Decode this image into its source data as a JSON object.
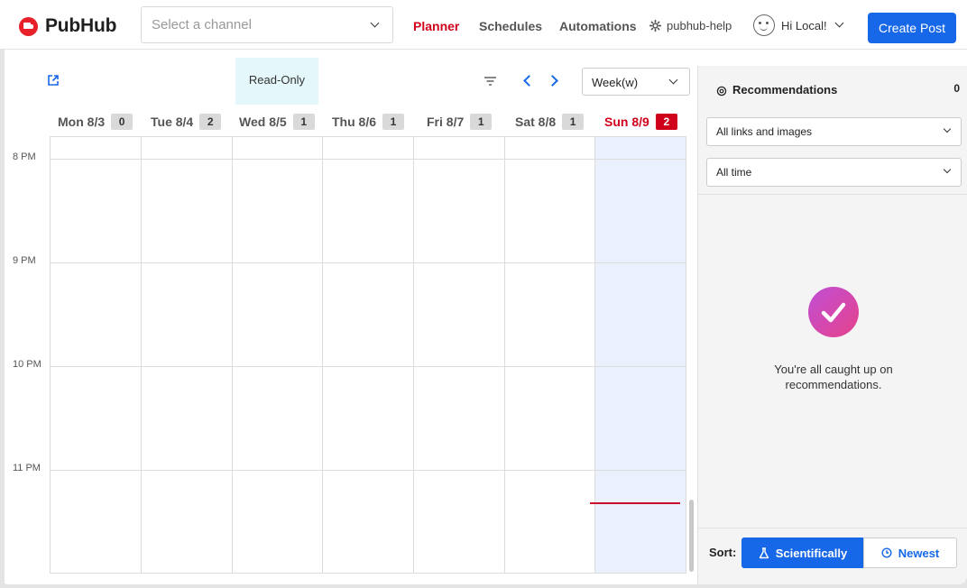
{
  "header": {
    "brand": "PubHub",
    "channel_placeholder": "Select a channel",
    "nav": {
      "planner": "Planner",
      "schedules": "Schedules",
      "automations": "Automations"
    },
    "help": "pubhub-help",
    "greeting": "Hi Local!",
    "create_post": "Create Post"
  },
  "toolbar": {
    "read_only": "Read-Only",
    "view": "Week(w)"
  },
  "days": [
    {
      "label": "Mon 8/3",
      "count": "0"
    },
    {
      "label": "Tue 8/4",
      "count": "2"
    },
    {
      "label": "Wed 8/5",
      "count": "1"
    },
    {
      "label": "Thu 8/6",
      "count": "1"
    },
    {
      "label": "Fri 8/7",
      "count": "1"
    },
    {
      "label": "Sat 8/8",
      "count": "1"
    },
    {
      "label": "Sun 8/9",
      "count": "2"
    }
  ],
  "times": [
    "8 PM",
    "9 PM",
    "10 PM",
    "11 PM"
  ],
  "recommendations": {
    "title": "Recommendations",
    "count": "0",
    "filter_type": "All links and images",
    "filter_time": "All time",
    "empty_line1": "You're all caught up on",
    "empty_line2": "recommendations.",
    "sort_label": "Sort:",
    "sort_scientific": "Scientifically",
    "sort_newest": "Newest"
  },
  "colors": {
    "accent": "#1768e8",
    "brand_red": "#d0021b",
    "today_bg": "#eaf1fd",
    "readonly_bg": "#e4f7fa"
  }
}
